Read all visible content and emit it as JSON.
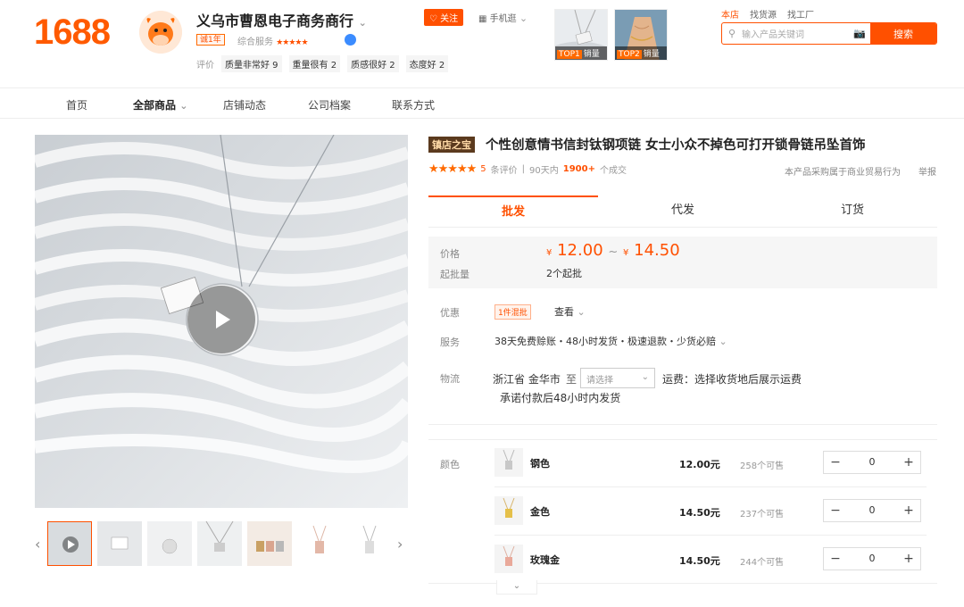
{
  "header": {
    "logo": "1688",
    "shop_name": "义乌市曹恩电子商务商行",
    "year_badge": "诚1年",
    "service_label": "综合服务",
    "service_stars": "★★★★★",
    "follow_label": "关注",
    "mobile_label": "手机逛",
    "eval_label": "评价",
    "eval_tags": [
      "质量非常好 9",
      "重量很有 2",
      "质感很好 2",
      "态度好 2"
    ],
    "top_products": [
      {
        "rank": "TOP1",
        "label": "销量"
      },
      {
        "rank": "TOP2",
        "label": "销量"
      }
    ],
    "search_scopes": [
      "本店",
      "找货源",
      "找工厂"
    ],
    "search_placeholder": "输入产品关键词",
    "search_button": "搜索"
  },
  "nav": {
    "items": [
      "首页",
      "全部商品",
      "店铺动态",
      "公司档案",
      "联系方式"
    ]
  },
  "product": {
    "badge": "镇店之宝",
    "title": "个性创意情书信封钛钢项链 女士小众不掉色可打开锁骨链吊坠首饰",
    "rating_stars": "★★★★★",
    "review_count": "5",
    "review_label": "条评价",
    "period": "90天内",
    "sales": "1900+",
    "sales_label": "个成交",
    "compliance": "本产品采购属于商业贸易行为",
    "report": "举报",
    "tabs": [
      "批发",
      "代发",
      "订货"
    ],
    "price_label": "价格",
    "price_low": "12.00",
    "price_high": "14.50",
    "currency": "¥",
    "price_sep": "~",
    "moq_label": "起批量",
    "moq": "2个起批",
    "promo_label": "优惠",
    "promo_tag": "1件混批",
    "promo_view": "查看",
    "service_label": "服务",
    "service": "38天免费赊账・48小时发货・极速退款・少货必赔",
    "logistics_label": "物流",
    "origin": "浙江省 金华市",
    "to_label": "至",
    "dest_placeholder": "请选择",
    "freight": "运费：选择收货地后展示运费",
    "ship_promise": "承诺付款后48小时内发货",
    "color_label": "颜色",
    "variants": [
      {
        "name": "钢色",
        "price": "12.00元",
        "stock": "258个可售",
        "qty": "0"
      },
      {
        "name": "金色",
        "price": "14.50元",
        "stock": "237个可售",
        "qty": "0"
      },
      {
        "name": "玫瑰金",
        "price": "14.50元",
        "stock": "244个可售",
        "qty": "0"
      }
    ]
  },
  "colors": {
    "accent": "#ff5000",
    "badge_bg": "#5b3a1e"
  }
}
